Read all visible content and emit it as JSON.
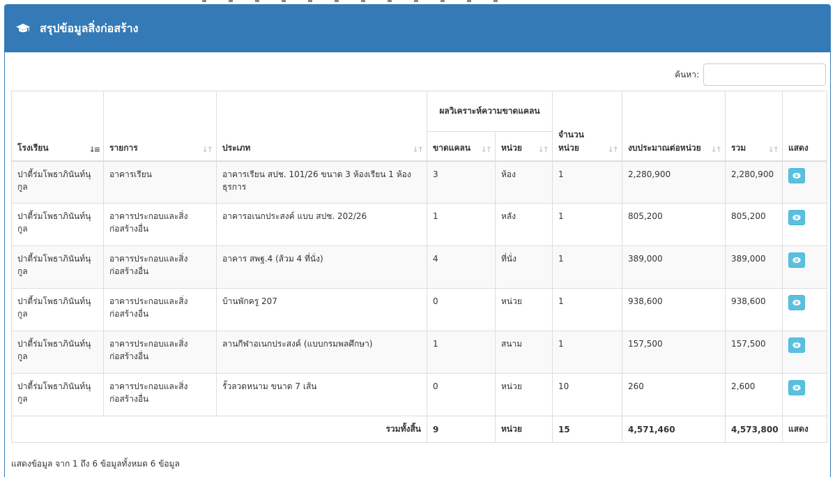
{
  "header": {
    "title": "สรุปข้อมูลสิ่งก่อสร้าง",
    "icon": "graduation-cap-icon"
  },
  "search": {
    "label": "ค้นหา:",
    "value": "",
    "placeholder": ""
  },
  "table": {
    "columns": {
      "school": "โรงเรียน",
      "item": "รายการ",
      "type": "ประเภท",
      "shortage_group": "ผลวิเคราะห์ความขาดแคลน",
      "shortage": "ขาดแคลน",
      "unit": "หน่วย",
      "quantity": "จำนวนหน่วย",
      "budget_per_unit": "งบประมาณต่อหน่วย",
      "total": "รวม",
      "show": "แสดง"
    },
    "rows": [
      {
        "school": "ปาตี้ร่มโพธาภินันท์นุกูล",
        "item": "อาคารเรียน",
        "type": "อาคารเรียน สปช. 101/26 ขนาด 3 ห้องเรียน 1 ห้องธุรการ",
        "shortage": "3",
        "unit": "ห้อง",
        "quantity": "1",
        "budget_per_unit": "2,280,900",
        "total": "2,280,900"
      },
      {
        "school": "ปาตี้ร่มโพธาภินันท์นุกูล",
        "item": "อาคารประกอบและสิ่งก่อสร้างอื่น",
        "type": "อาคารอเนกประสงค์ แบบ สปช. 202/26",
        "shortage": "1",
        "unit": "หลัง",
        "quantity": "1",
        "budget_per_unit": "805,200",
        "total": "805,200"
      },
      {
        "school": "ปาตี้ร่มโพธาภินันท์นุกูล",
        "item": "อาคารประกอบและสิ่งก่อสร้างอื่น",
        "type": "อาคาร สพฐ.4 (ส้วม 4 ที่นั่ง)",
        "shortage": "4",
        "unit": "ที่นั่ง",
        "quantity": "1",
        "budget_per_unit": "389,000",
        "total": "389,000"
      },
      {
        "school": "ปาตี้ร่มโพธาภินันท์นุกูล",
        "item": "อาคารประกอบและสิ่งก่อสร้างอื่น",
        "type": "บ้านพักครู 207",
        "shortage": "0",
        "unit": "หน่วย",
        "quantity": "1",
        "budget_per_unit": "938,600",
        "total": "938,600"
      },
      {
        "school": "ปาตี้ร่มโพธาภินันท์นุกูล",
        "item": "อาคารประกอบและสิ่งก่อสร้างอื่น",
        "type": "ลานกีฬาอเนกประสงค์ (แบบกรมพลศึกษา)",
        "shortage": "1",
        "unit": "สนาม",
        "quantity": "1",
        "budget_per_unit": "157,500",
        "total": "157,500"
      },
      {
        "school": "ปาตี้ร่มโพธาภินันท์นุกูล",
        "item": "อาคารประกอบและสิ่งก่อสร้างอื่น",
        "type": "รั้วลวดหนาม ขนาด 7 เส้น",
        "shortage": "0",
        "unit": "หน่วย",
        "quantity": "10",
        "budget_per_unit": "260",
        "total": "2,600"
      }
    ],
    "footer": {
      "label": "รวมทั้งสิ้น",
      "shortage": "9",
      "unit": "หน่วย",
      "quantity": "15",
      "budget_per_unit": "4,571,460",
      "total": "4,573,800",
      "show": "แสดง"
    }
  },
  "info": "แสดงข้อมูล จาก 1 ถึง 6 ข้อมูลทั้งหมด 6 ข้อมูล",
  "colors": {
    "primary": "#337ab7",
    "info_button": "#5bc0de",
    "border": "#dddddd",
    "stripe": "#f9f9f9"
  }
}
